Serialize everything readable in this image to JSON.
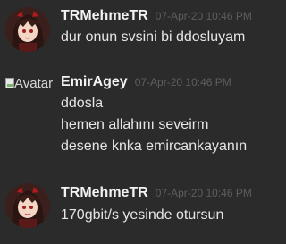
{
  "messages": [
    {
      "username": "TRMehmeTR",
      "timestamp": "07-Apr-20 10:46 PM",
      "avatar": "anime-girl-avatar",
      "lines": [
        "dur onun svsini bi ddosluyam"
      ]
    },
    {
      "username": "EmirAgey",
      "timestamp": "07-Apr-20 10:46 PM",
      "avatar_alt": "Avatar",
      "lines": [
        "ddosla",
        "hemen allahını seveirm",
        "desene knka emircankayanın"
      ]
    },
    {
      "username": "TRMehmeTR",
      "timestamp": "07-Apr-20 10:46 PM",
      "avatar": "anime-girl-avatar",
      "lines": [
        "170gbit/s yesinde otursun"
      ]
    }
  ],
  "colors": {
    "background": "#2b2b2b",
    "username": "#f2f2f2",
    "timestamp": "#5e5e5e",
    "text": "#e6e6e6"
  }
}
